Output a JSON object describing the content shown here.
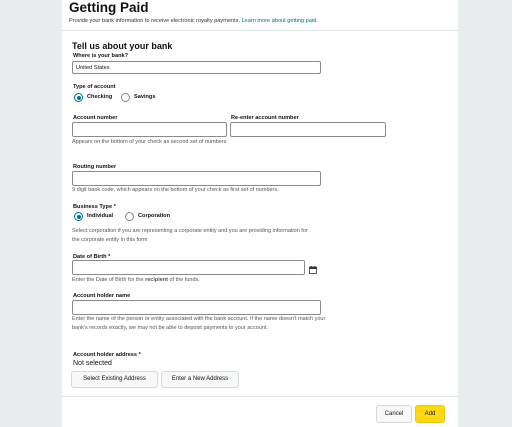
{
  "header": {
    "title": "Getting Paid",
    "subtitle": "Provide your bank information to receive electronic royalty payments.",
    "link": "Learn more about getting paid."
  },
  "section_title": "Tell us about your bank",
  "bank_location": {
    "label": "Where is your bank?",
    "value": "United States"
  },
  "account_type": {
    "label": "Type of account",
    "options": [
      "Checking",
      "Savings"
    ],
    "selected": "Checking"
  },
  "account_number": {
    "label": "Account number",
    "help": "Appears on the bottom of your check as second set of numbers.",
    "value": ""
  },
  "reenter_account": {
    "label": "Re-enter account number",
    "value": ""
  },
  "routing": {
    "label": "Routing number",
    "help": "9 digit bank code, which appears on the bottom of your check as first set of numbers.",
    "value": ""
  },
  "business_type": {
    "label": "Business Type *",
    "options": [
      "Individual",
      "Corporation"
    ],
    "selected": "Individual",
    "help": "Select corporation if you are representing a corporate entity and you are providing information for the corporate entity in this form"
  },
  "dob": {
    "label": "Date of Birth *",
    "help_prefix": "Enter the Date of Birth for the",
    "help_bold": "recipient",
    "help_suffix": "of the funds.",
    "value": ""
  },
  "holder_name": {
    "label": "Account holder name",
    "help": "Enter the name of the person or entity associated with the bank account. If the name doesn't match your bank's records exactly, we may not be able to deposit payments to your account.",
    "value": ""
  },
  "holder_address": {
    "label": "Account holder address *",
    "value": "Not selected",
    "select_existing": "Select Existing Address",
    "enter_new": "Enter a New Address"
  },
  "footer": {
    "cancel": "Cancel",
    "add": "Add"
  },
  "colors": {
    "accent": "#007185",
    "primary_button": "#ffd814",
    "background": "#eaeded"
  }
}
